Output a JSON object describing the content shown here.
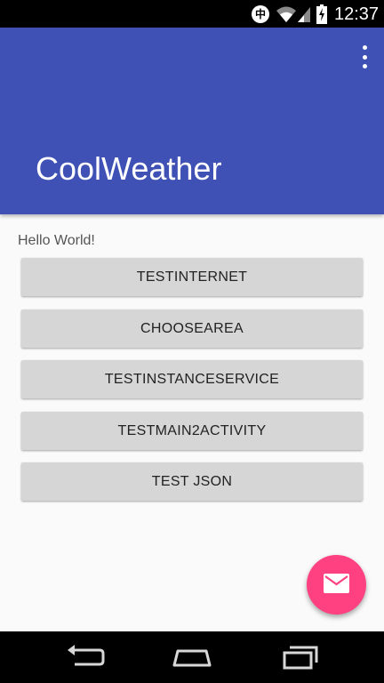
{
  "status_bar": {
    "ime_label": "中",
    "time": "12:37",
    "icons": [
      "ime-icon",
      "wifi-icon",
      "signal-icon",
      "battery-charging-icon"
    ]
  },
  "app_bar": {
    "title": "CoolWeather",
    "color": "#3f51b5",
    "menu_icon": "overflow-menu-icon"
  },
  "main": {
    "hello_text": "Hello World!",
    "buttons": [
      {
        "label": "TESTINTERNET"
      },
      {
        "label": "CHOOSEAREA"
      },
      {
        "label": "TESTINSTANCESERVICE"
      },
      {
        "label": "TESTMAIN2ACTIVITY"
      },
      {
        "label": "TEST JSON"
      }
    ]
  },
  "fab": {
    "icon": "mail-icon",
    "color": "#ff4081"
  },
  "nav_bar": {
    "icons": [
      "back-icon",
      "home-icon",
      "recents-icon"
    ]
  }
}
